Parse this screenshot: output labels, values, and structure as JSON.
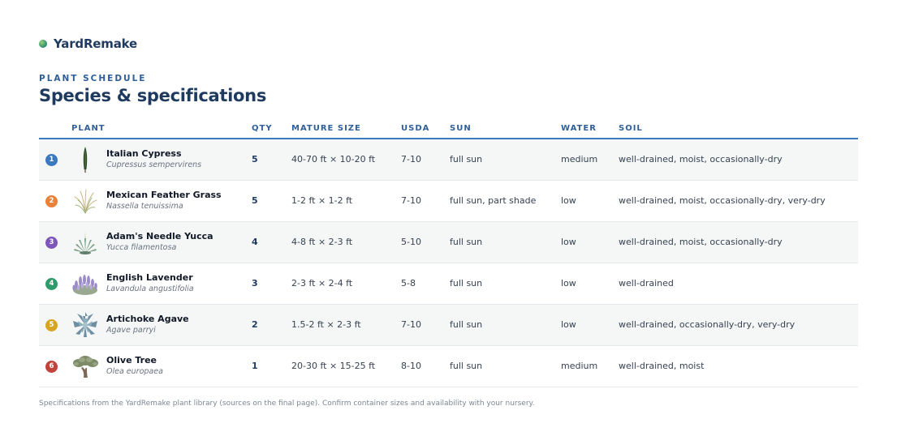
{
  "brand": {
    "name": "YardRemake"
  },
  "header": {
    "eyebrow": "PLANT SCHEDULE",
    "title": "Species & specifications"
  },
  "table": {
    "columns": [
      "PLANT",
      "QTY",
      "MATURE SIZE",
      "USDA",
      "SUN",
      "WATER",
      "SOIL"
    ],
    "rows": [
      {
        "num": "1",
        "color": "#3b78c2",
        "icon": "cypress-icon",
        "name": "Italian Cypress",
        "latin": "Cupressus sempervirens",
        "qty": "5",
        "size": "40-70 ft × 10-20 ft",
        "usda": "7-10",
        "sun": "full sun",
        "water": "medium",
        "soil": "well-drained, moist, occasionally-dry"
      },
      {
        "num": "2",
        "color": "#e8823a",
        "icon": "feather-grass-icon",
        "name": "Mexican Feather Grass",
        "latin": "Nassella tenuissima",
        "qty": "5",
        "size": "1-2 ft × 1-2 ft",
        "usda": "7-10",
        "sun": "full sun, part shade",
        "water": "low",
        "soil": "well-drained, moist, occasionally-dry, very-dry"
      },
      {
        "num": "3",
        "color": "#7c56b8",
        "icon": "yucca-icon",
        "name": "Adam's Needle Yucca",
        "latin": "Yucca filamentosa",
        "qty": "4",
        "size": "4-8 ft × 2-3 ft",
        "usda": "5-10",
        "sun": "full sun",
        "water": "low",
        "soil": "well-drained, moist, occasionally-dry"
      },
      {
        "num": "4",
        "color": "#2f9b6a",
        "icon": "lavender-icon",
        "name": "English Lavender",
        "latin": "Lavandula angustifolia",
        "qty": "3",
        "size": "2-3 ft × 2-4 ft",
        "usda": "5-8",
        "sun": "full sun",
        "water": "low",
        "soil": "well-drained"
      },
      {
        "num": "5",
        "color": "#d6a521",
        "icon": "agave-icon",
        "name": "Artichoke Agave",
        "latin": "Agave parryi",
        "qty": "2",
        "size": "1.5-2 ft × 2-3 ft",
        "usda": "7-10",
        "sun": "full sun",
        "water": "low",
        "soil": "well-drained, occasionally-dry, very-dry"
      },
      {
        "num": "6",
        "color": "#c0443c",
        "icon": "olive-tree-icon",
        "name": "Olive Tree",
        "latin": "Olea europaea",
        "qty": "1",
        "size": "20-30 ft × 15-25 ft",
        "usda": "8-10",
        "sun": "full sun",
        "water": "medium",
        "soil": "well-drained, moist"
      }
    ]
  },
  "footnote": "Specifications from the YardRemake plant library (sources on the final page). Confirm container sizes and availability with your nursery."
}
